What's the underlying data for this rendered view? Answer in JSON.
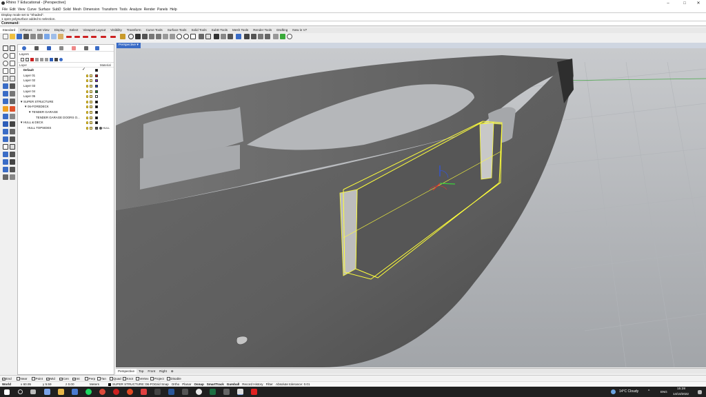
{
  "window": {
    "title": "Rhino 7 Educational - [Perspective]",
    "minimize": "–",
    "maximize": "□",
    "close": "✕"
  },
  "menu": [
    "File",
    "Edit",
    "View",
    "Curve",
    "Surface",
    "SubD",
    "Solid",
    "Mesh",
    "Dimension",
    "Transform",
    "Tools",
    "Analyze",
    "Render",
    "Panels",
    "Help"
  ],
  "history": [
    "Display mode set to \"Shaded\".",
    "1 open polysurface added to selection."
  ],
  "command": {
    "label": "Command:",
    "value": ""
  },
  "tabs": [
    "Standard",
    "CPlanes",
    "Set View",
    "Display",
    "Select",
    "Viewport Layout",
    "Visibility",
    "Transform",
    "Curve Tools",
    "Surface Tools",
    "Solid Tools",
    "SubD Tools",
    "Mesh Tools",
    "Render Tools",
    "Drafting",
    "New in V7"
  ],
  "layers_panel": {
    "title": "Layers",
    "col_layer": "Layer",
    "col_material": "Material",
    "rows": [
      {
        "name": "Default",
        "indent": 0,
        "bold": true,
        "current": true,
        "color": "#000000",
        "expander": ""
      },
      {
        "name": "Layer 01",
        "indent": 0,
        "color": "#cc0000",
        "expander": ""
      },
      {
        "name": "Layer 02",
        "indent": 0,
        "color": "#7a2bd1",
        "expander": ""
      },
      {
        "name": "Layer 03",
        "indent": 0,
        "color": "#1a3fd1",
        "expander": ""
      },
      {
        "name": "Layer 04",
        "indent": 0,
        "color": "#1f8a2e",
        "expander": ""
      },
      {
        "name": "Layer 05",
        "indent": 0,
        "color": "#ffffff",
        "expander": ""
      },
      {
        "name": "SUPER STRUCTURE",
        "indent": 0,
        "color": "#000000",
        "expander": "▼"
      },
      {
        "name": "06-FOREDECK",
        "indent": 1,
        "color": "#000000",
        "expander": "▼"
      },
      {
        "name": "TENDER GARAGE",
        "indent": 2,
        "color": "#000000",
        "expander": "▼"
      },
      {
        "name": "TENDER GARAGE DOORS O...",
        "indent": 3,
        "color": "#000000",
        "expander": ""
      },
      {
        "name": "HULL & DECK",
        "indent": 0,
        "color": "#000000",
        "expander": "▼"
      },
      {
        "name": "HULL TOPSIDES",
        "indent": 1,
        "color": "#555555",
        "expander": "",
        "material": "HULL"
      }
    ]
  },
  "viewport": {
    "label": "Perspective",
    "menu_arrow": "▾"
  },
  "view_tabs": [
    "Perspective",
    "Top",
    "Front",
    "Right",
    "⊕"
  ],
  "osnaps": [
    {
      "label": "End",
      "checked": true
    },
    {
      "label": "Near",
      "checked": false
    },
    {
      "label": "Point",
      "checked": false
    },
    {
      "label": "Mid",
      "checked": true
    },
    {
      "label": "Cen",
      "checked": true
    },
    {
      "label": "Int",
      "checked": true
    },
    {
      "label": "Perp",
      "checked": false
    },
    {
      "label": "Tan",
      "checked": false
    },
    {
      "label": "Quad",
      "checked": false
    },
    {
      "label": "Knot",
      "checked": false
    },
    {
      "label": "Vertex",
      "checked": false
    },
    {
      "label": "Project",
      "checked": false
    },
    {
      "label": "Disable",
      "checked": false
    }
  ],
  "status": {
    "cplane": "World",
    "x": "x 60.95",
    "y": "y 5.59",
    "z": "z 0.00",
    "units": "Meters",
    "layer": "SUPER STRUCTURE::06-FO...",
    "toggles": [
      {
        "label": "Grid Snap",
        "bold": false
      },
      {
        "label": "Ortho",
        "bold": false
      },
      {
        "label": "Planar",
        "bold": false
      },
      {
        "label": "Osnap",
        "bold": true
      },
      {
        "label": "SmartTrack",
        "bold": true
      },
      {
        "label": "Gumball",
        "bold": true
      },
      {
        "label": "Record History",
        "bold": false
      },
      {
        "label": "Filter",
        "bold": false
      }
    ],
    "tolerance": "Absolute tolerance: 0.01"
  },
  "taskbar": {
    "weather": "14°C  Cloudy",
    "lang": "ENG",
    "time": "15:28",
    "date": "14/10/2022"
  },
  "colors": {
    "selection": "#ffff3a",
    "viewport_bg": "#a9acb0",
    "hull": "#5c5c5c",
    "gumball_x": "#e8342c",
    "gumball_y": "#3bd33b",
    "gumball_z": "#2e55e6"
  }
}
